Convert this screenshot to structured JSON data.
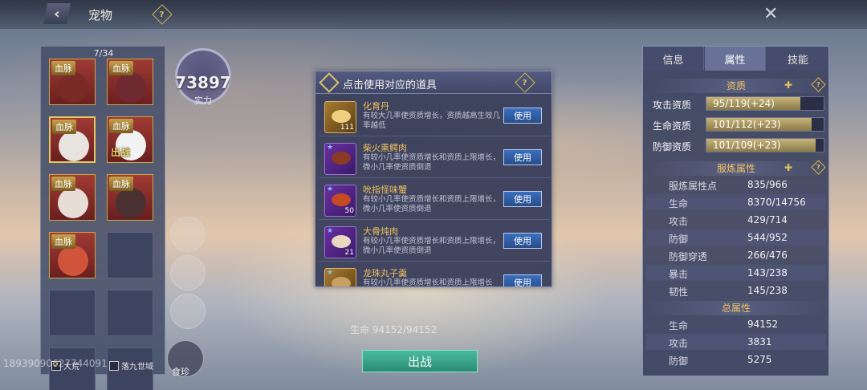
{
  "header": {
    "back_icon": "‹",
    "title": "宠物",
    "help_icon": "?",
    "close_icon": "✕"
  },
  "pet_panel": {
    "count": "7/34",
    "pets": [
      {
        "bloodline": "血脉",
        "color": "#7a2a25",
        "deployed": ""
      },
      {
        "bloodline": "血脉",
        "color": "#6e2a30",
        "deployed": ""
      },
      {
        "bloodline": "血脉",
        "color": "#e9e3e0",
        "deployed": ""
      },
      {
        "bloodline": "血脉",
        "color": "#f2f2f2",
        "deployed": "出战"
      },
      {
        "bloodline": "血脉",
        "color": "#e7dcd6",
        "deployed": ""
      },
      {
        "bloodline": "血脉",
        "color": "#4a3030",
        "deployed": ""
      },
      {
        "bloodline": "血脉",
        "color": "#d0543a",
        "deployed": ""
      }
    ],
    "filters": [
      {
        "label": "大荒",
        "checked": true
      },
      {
        "label": "落九世域",
        "checked": false
      }
    ]
  },
  "power": {
    "value": "73897",
    "label": "实力"
  },
  "feed": {
    "label": "食珍"
  },
  "watermark": "18939090627744091",
  "popup": {
    "title": "点击使用对应的道具",
    "help": "?",
    "items": [
      {
        "name": "化育丹",
        "desc": "有较大几率使资质增长，资质越高生效几率越低",
        "qty": "111",
        "button": "使用",
        "icon": "gold",
        "food": "#f0d080",
        "starred": false
      },
      {
        "name": "柴火熏鳄肉",
        "desc": "有较小几率使资质增长和资质上限增长，微小几率使资质倒退",
        "qty": "",
        "button": "使用",
        "icon": "purple",
        "food": "#8a3a22",
        "starred": true
      },
      {
        "name": "吮指怪味蟹",
        "desc": "有较小几率使资质增长和资质上限增长，微小几率使资质倒退",
        "qty": "50",
        "button": "使用",
        "icon": "purple",
        "food": "#c44a22",
        "starred": true
      },
      {
        "name": "大骨炖肉",
        "desc": "有较小几率使资质增长和资质上限增长，微小几率使资质倒退",
        "qty": "21",
        "button": "使用",
        "icon": "purple",
        "food": "#e8d8c0",
        "starred": true
      },
      {
        "name": "龙珠丸子羹",
        "desc": "有较小几率使资质增长和资质上限增长",
        "qty": "",
        "button": "使用",
        "icon": "gold",
        "food": "#c8a060",
        "starred": true
      }
    ]
  },
  "deploy_button": "出战",
  "hp_line": "生命 94152/94152",
  "stats": {
    "tabs": [
      "信息",
      "属性",
      "技能"
    ],
    "active_tab": 1,
    "aptitude": {
      "title": "资质",
      "rows": [
        {
          "label": "攻击资质",
          "value": "95/119(+24)",
          "fill": 0.8
        },
        {
          "label": "生命资质",
          "value": "101/112(+23)",
          "fill": 0.9
        },
        {
          "label": "防御资质",
          "value": "101/109(+23)",
          "fill": 0.93
        }
      ]
    },
    "refine": {
      "title": "服炼属性",
      "rows": [
        {
          "k": "服炼属性点",
          "v": "835/966"
        },
        {
          "k": "生命",
          "v": "8370/14756"
        },
        {
          "k": "攻击",
          "v": "429/714"
        },
        {
          "k": "防御",
          "v": "544/952"
        },
        {
          "k": "防御穿透",
          "v": "266/476"
        },
        {
          "k": "暴击",
          "v": "143/238"
        },
        {
          "k": "韧性",
          "v": "145/238"
        }
      ]
    },
    "total": {
      "title": "总属性",
      "rows": [
        {
          "k": "生命",
          "v": "94152"
        },
        {
          "k": "攻击",
          "v": "3831"
        },
        {
          "k": "防御",
          "v": "5275"
        }
      ]
    }
  }
}
